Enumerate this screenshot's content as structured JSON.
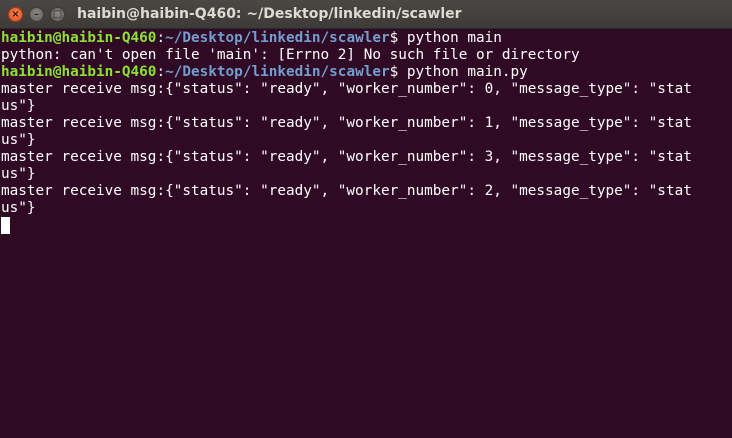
{
  "window": {
    "title": "haibin@haibin-Q460: ~/Desktop/linkedin/scawler",
    "close_glyph": "×",
    "minimize_glyph": "–",
    "maximize_glyph": "□"
  },
  "colors": {
    "background": "#300a24",
    "text": "#ffffff",
    "userhost": "#8ae234",
    "path": "#729fcf",
    "titlebar": "#3c3b37",
    "close_button": "#df4a16"
  },
  "terminal": {
    "prompt1": {
      "userhost": "haibin@haibin-Q460",
      "colon": ":",
      "path": "~/Desktop/linkedin/scawler",
      "command": "$ python main"
    },
    "error_line": "python: can't open file 'main': [Errno 2] No such file or directory",
    "prompt2": {
      "userhost": "haibin@haibin-Q460",
      "colon": ":",
      "path": "~/Desktop/linkedin/scawler",
      "command": "$ python main.py"
    },
    "output": [
      "master receive msg:{\"status\": \"ready\", \"worker_number\": 0, \"message_type\": \"stat",
      "us\"}",
      "master receive msg:{\"status\": \"ready\", \"worker_number\": 1, \"message_type\": \"stat",
      "us\"}",
      "master receive msg:{\"status\": \"ready\", \"worker_number\": 3, \"message_type\": \"stat",
      "us\"}",
      "master receive msg:{\"status\": \"ready\", \"worker_number\": 2, \"message_type\": \"stat",
      "us\"}"
    ]
  }
}
